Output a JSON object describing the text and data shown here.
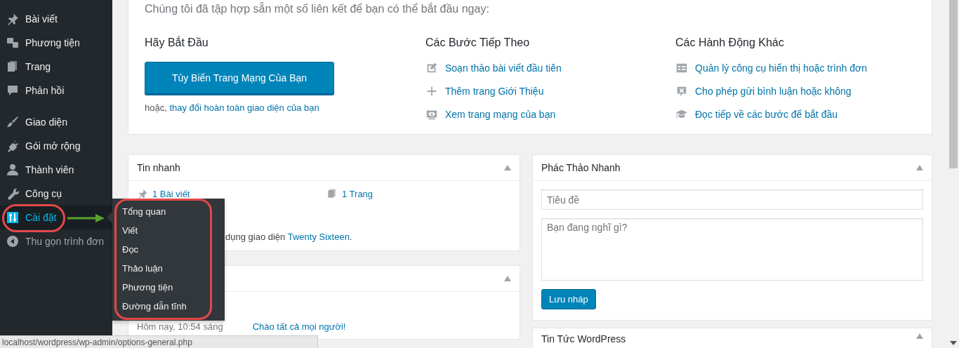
{
  "sidebar": {
    "groups": [
      [
        {
          "label": "Bài viết",
          "selected": false
        },
        {
          "label": "Phương tiện",
          "selected": false
        },
        {
          "label": "Trang",
          "selected": false
        },
        {
          "label": "Phản hồi",
          "selected": false
        }
      ],
      [
        {
          "label": "Giao diện",
          "selected": false
        },
        {
          "label": "Gói mở rộng",
          "selected": false
        },
        {
          "label": "Thành viên",
          "selected": false
        },
        {
          "label": "Công cụ",
          "selected": false
        },
        {
          "label": "Cài đặt",
          "selected": true,
          "submenu": [
            "Tổng quan",
            "Viết",
            "Đọc",
            "Thảo luận",
            "Phương tiện",
            "Đường dẫn tĩnh"
          ]
        }
      ]
    ],
    "collapse_label": "Thu gọn trình đơn"
  },
  "welcome": {
    "subtitle": "Chúng tôi đã tập hợp sẵn một số liên kết để bạn có thể bắt đầu ngay:",
    "start": {
      "heading": "Hãy Bắt Đầu",
      "button": "Tùy Biến Trang Mạng Của Bạn",
      "alt_prefix": "hoặc,",
      "alt_link": "thay đổi hoàn toàn giao diện của bạn"
    },
    "next_steps": {
      "heading": "Các Bước Tiếp Theo",
      "links": [
        "Soạn thảo bài viết đầu tiên",
        "Thêm trang Giới Thiệu",
        "Xem trang mạng của bạn"
      ]
    },
    "more_actions": {
      "heading": "Các Hành Động Khác",
      "links": [
        "Quản lý công cụ hiển thị hoặc trình đơn",
        "Cho phép gửi bình luận hoặc không",
        "Đọc tiếp về các bước để bắt đầu"
      ]
    }
  },
  "at_a_glance": {
    "title": "Tin nhanh",
    "counts": [
      "1 Bài viết",
      "1 Trang"
    ],
    "theme_text": "dụng giao diện",
    "theme_link": "Twenty Sixteen",
    "theme_end": "."
  },
  "activity": {
    "rows": [
      {
        "time": "Hôm nay, 10:54 sáng",
        "link": "Chào tất cả mọi người!"
      }
    ]
  },
  "quick_draft": {
    "title": "Phác Thảo Nhanh",
    "title_placeholder": "Tiêu đề",
    "content_placeholder": "Bạn đang nghĩ gì?",
    "button": "Lưu nháp"
  },
  "news": {
    "title": "Tin Tức WordPress"
  },
  "status_bar": "localhost/wordpress/wp-admin/options-general.php"
}
